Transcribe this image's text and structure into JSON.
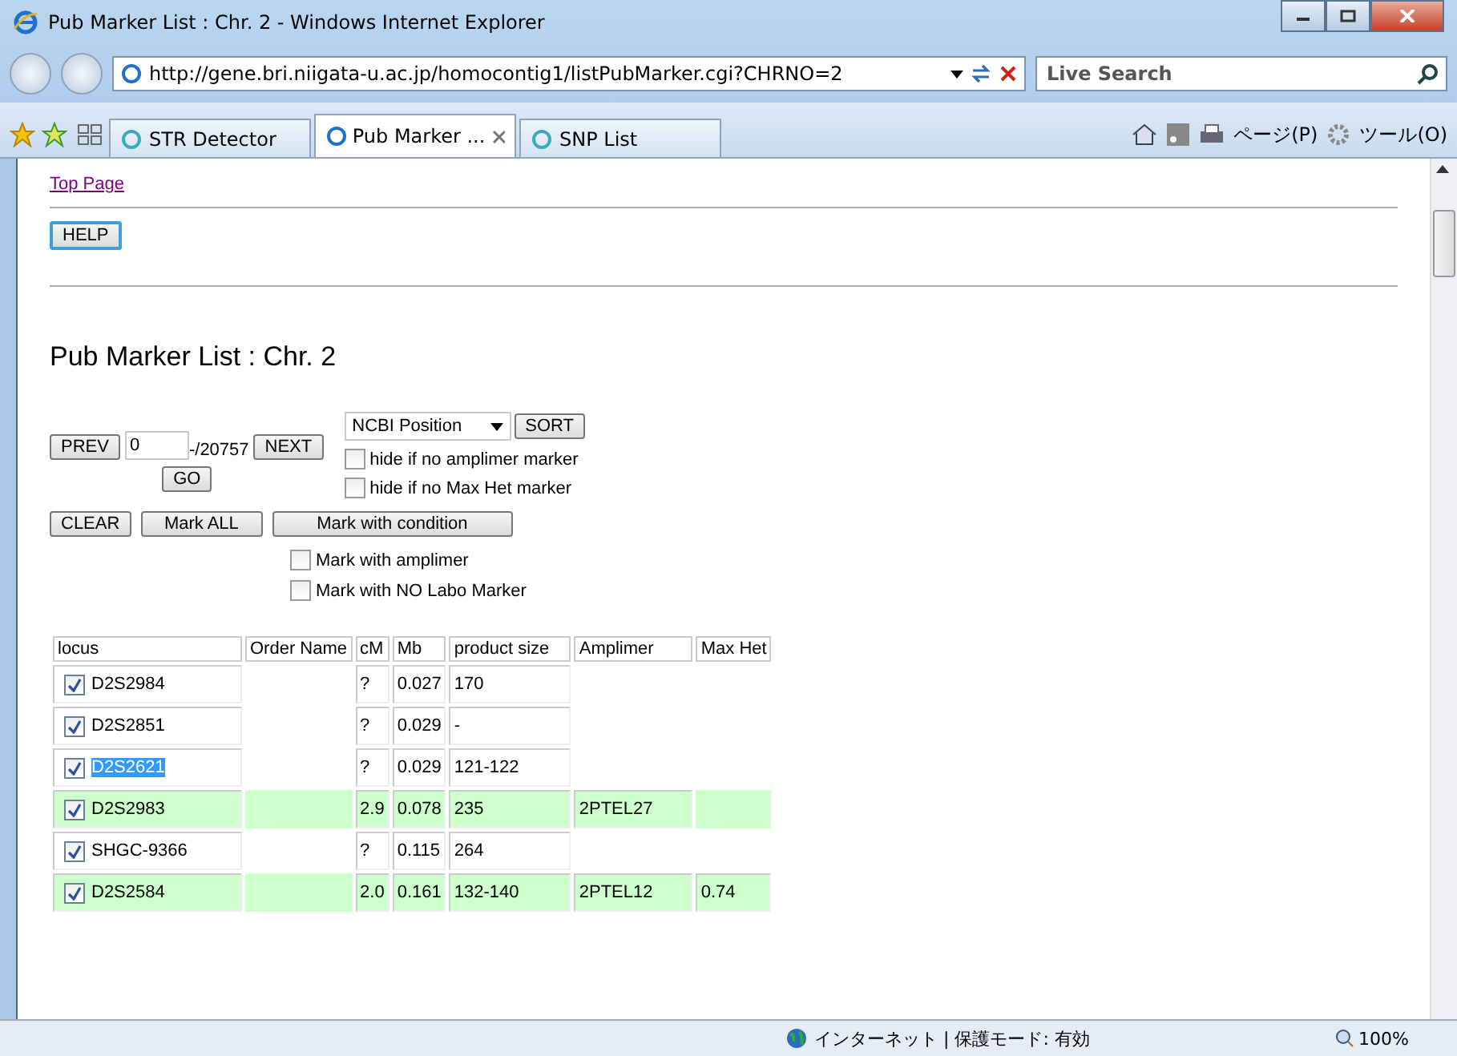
{
  "window": {
    "title": "Pub Marker List : Chr. 2 - Windows Internet Explorer"
  },
  "address_bar": {
    "url": "http://gene.bri.niigata-u.ac.jp/homocontig1/listPubMarker.cgi?CHRNO=2",
    "search_placeholder": "Live Search"
  },
  "tabs": [
    {
      "label": "STR Detector",
      "selected": false
    },
    {
      "label": "Pub Marker ...",
      "selected": true
    },
    {
      "label": "SNP List",
      "selected": false
    }
  ],
  "toolbar": {
    "page_menu": "ページ(P)",
    "tools_menu": "ツール(O)"
  },
  "page": {
    "top_link": "Top Page",
    "help_button": "HELP",
    "heading": "Pub Marker List : Chr. 2",
    "prev_button": "PREV",
    "position_value": "0",
    "total": "-/20757",
    "next_button": "NEXT",
    "go_button": "GO",
    "sort_select": "NCBI Position",
    "sort_button": "SORT",
    "hide_options": [
      {
        "label": "hide if no amplimer marker",
        "checked": false
      },
      {
        "label": "hide if no Max Het marker",
        "checked": false
      }
    ],
    "clear_button": "CLEAR",
    "mark_all_button": "Mark ALL",
    "mark_condition_button": "Mark with condition",
    "mark_options": [
      {
        "label": "Mark with amplimer",
        "checked": false
      },
      {
        "label": "Mark with NO Labo Marker",
        "checked": false
      }
    ]
  },
  "table": {
    "columns": [
      "locus",
      "Order Name",
      "cM",
      "Mb",
      "product size",
      "Amplimer",
      "Max Het"
    ],
    "rows": [
      {
        "checked": true,
        "highlighted": false,
        "selected": false,
        "cells": [
          "D2S2984",
          "",
          "?",
          "0.027",
          "170",
          "",
          ""
        ]
      },
      {
        "checked": true,
        "highlighted": false,
        "selected": false,
        "cells": [
          "D2S2851",
          "",
          "?",
          "0.029",
          "-",
          "",
          ""
        ]
      },
      {
        "checked": true,
        "highlighted": false,
        "selected": true,
        "cells": [
          "D2S2621",
          "",
          "?",
          "0.029",
          "121-122",
          "",
          ""
        ]
      },
      {
        "checked": true,
        "highlighted": true,
        "selected": false,
        "cells": [
          "D2S2983",
          "",
          "2.9",
          "0.078",
          "235",
          "2PTEL27",
          ""
        ]
      },
      {
        "checked": true,
        "highlighted": false,
        "selected": false,
        "cells": [
          "SHGC-9366",
          "",
          "?",
          "0.115",
          "264",
          "",
          ""
        ]
      },
      {
        "checked": true,
        "highlighted": true,
        "selected": false,
        "cells": [
          "D2S2584",
          "",
          "2.0",
          "0.161",
          "132-140",
          "2PTEL12",
          "0.74"
        ]
      }
    ]
  },
  "status_bar": {
    "zone": "インターネット | 保護モード: 有効",
    "zoom": "100%"
  }
}
